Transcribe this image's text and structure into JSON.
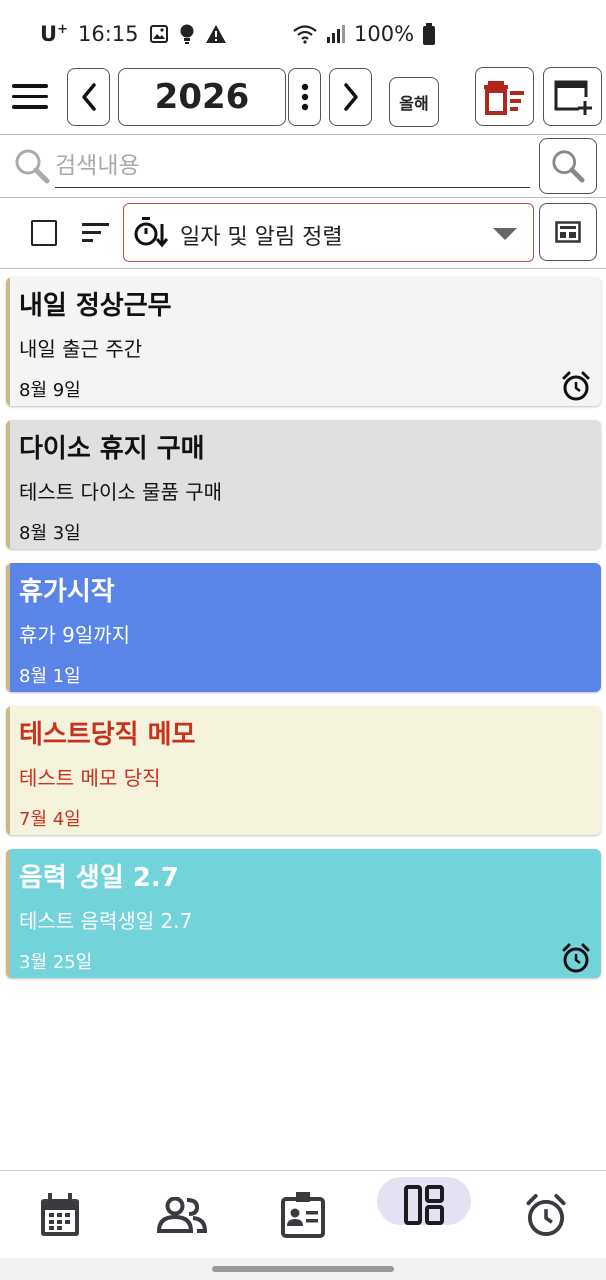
{
  "status_bar": {
    "carrier": "U",
    "carrier_sup": "+",
    "time": "16:15",
    "battery": "100%"
  },
  "toolbar": {
    "year": "2026",
    "today_label": "올해"
  },
  "search": {
    "placeholder": "검색내용"
  },
  "sort": {
    "label": "일자 및 알림 정렬"
  },
  "colors": {
    "accent_red": "#b3261e",
    "card_gray_light": "#f4f4f4",
    "card_gray": "#e0e0e0",
    "card_blue": "#5b84e8",
    "card_cream": "#f6f3dc",
    "card_cyan": "#72d3db"
  },
  "cards": [
    {
      "title": "내일 정상근무",
      "desc": "내일 출근 주간",
      "date": "8월 9일",
      "alarm": true,
      "bg": "#f4f4f4",
      "fg": "#111111"
    },
    {
      "title": "다이소 휴지 구매",
      "desc": "테스트 다이소 물품 구매",
      "date": "8월 3일",
      "alarm": false,
      "bg": "#e0e0e0",
      "fg": "#111111"
    },
    {
      "title": "휴가시작",
      "desc": "휴가 9일까지",
      "date": "8월 1일",
      "alarm": false,
      "bg": "#5b84e8",
      "fg": "#ffffff"
    },
    {
      "title": "테스트당직 메모",
      "desc": "테스트 메모 당직",
      "date": "7월 4일",
      "alarm": false,
      "bg": "#f6f3dc",
      "fg": "#c8321e"
    },
    {
      "title": "음력 생일 2.7",
      "desc": "테스트 음력생일 2.7",
      "date": "3월 25일",
      "alarm": true,
      "bg": "#72d3db",
      "fg": "#ffffff"
    }
  ],
  "bottom_nav": {
    "items": [
      "calendar-icon",
      "people-icon",
      "contact-card-icon",
      "dashboard-icon",
      "alarm-clock-icon"
    ],
    "active": "dashboard-icon"
  }
}
